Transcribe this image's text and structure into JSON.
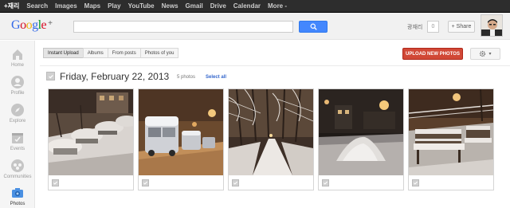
{
  "topbar": {
    "items": [
      "+재리",
      "Search",
      "Images",
      "Maps",
      "Play",
      "YouTube",
      "News",
      "Gmail",
      "Drive",
      "Calendar",
      "More -"
    ]
  },
  "header": {
    "logo": {
      "g": "G",
      "o1": "o",
      "o2": "o",
      "g2": "g",
      "l": "l",
      "e": "e",
      "plus": "+"
    },
    "search_value": "",
    "user_name": "광재리",
    "notification_count": "0",
    "share_label": "+ Share"
  },
  "sidebar": {
    "items": [
      {
        "label": "Home",
        "icon": "home-icon"
      },
      {
        "label": "Profile",
        "icon": "profile-icon"
      },
      {
        "label": "Explore",
        "icon": "explore-icon"
      },
      {
        "label": "Events",
        "icon": "events-icon"
      },
      {
        "label": "Communities",
        "icon": "communities-icon"
      },
      {
        "label": "Photos",
        "icon": "camera-icon",
        "active": true
      }
    ]
  },
  "toolbar": {
    "tabs": [
      "Instant Upload",
      "Albums",
      "From posts",
      "Photos of you"
    ],
    "upload_label": "UPLOAD NEW PHOTOS",
    "settings_caret": "▾"
  },
  "group": {
    "date": "Friday, February 22, 2013",
    "count": "5 photos",
    "select_all": "Select all"
  },
  "photos": [
    {
      "name": "snowy-parked-cars"
    },
    {
      "name": "snow-covered-van"
    },
    {
      "name": "snowy-tree-lined-path"
    },
    {
      "name": "snow-mound-at-night"
    },
    {
      "name": "snowy-benches"
    }
  ],
  "colors": {
    "accent_blue": "#4387fd",
    "upload_red": "#d14836",
    "topbar": "#2d2d2d",
    "link": "#3366cc"
  }
}
